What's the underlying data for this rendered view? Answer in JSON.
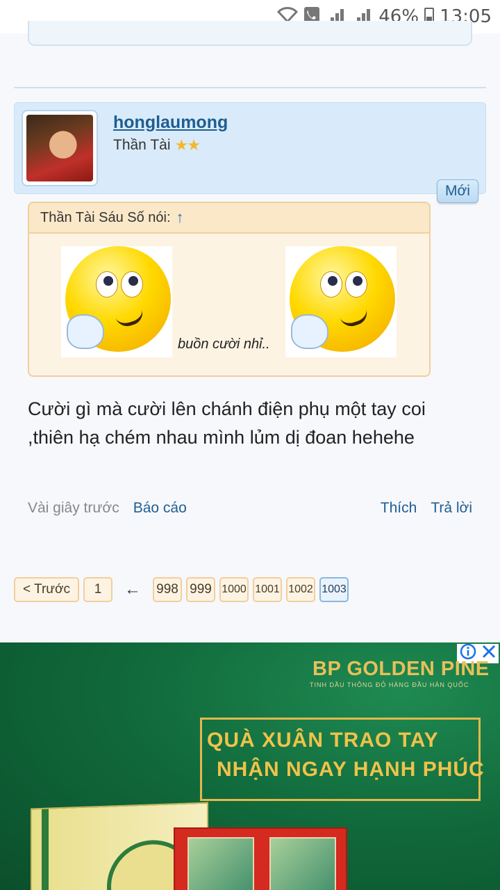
{
  "status_bar": {
    "battery": "46%",
    "time": "13:05"
  },
  "post": {
    "username": "honglaumong",
    "rank": "Thần Tài",
    "new_badge": "Mới",
    "quote": {
      "author_line": "Thần Tài Sáu Số nói:",
      "up_arrow": "↑",
      "text": "buồn cười nhỉ.."
    },
    "body": "Cười gì mà cười lên chánh điện phụ một tay coi ,thiên hạ chém nhau mình lủm dị đoan hehehe",
    "time": "Vài giây trước",
    "report": "Báo cáo",
    "like": "Thích",
    "reply": "Trả lời"
  },
  "pagination": {
    "prev": "< Trước",
    "first": "1",
    "gap_arrow": "←",
    "pages": [
      "998",
      "999",
      "1000",
      "1001",
      "1002",
      "1003"
    ],
    "current": "1003"
  },
  "ad": {
    "brand": "BP GOLDEN PINE",
    "tagline": "TINH DẦU THÔNG ĐỎ HÀNG ĐẦU HÀN QUỐC",
    "line1": "QUÀ XUÂN TRAO TAY",
    "line2": "NHẬN NGAY HẠNH PHÚC",
    "info_icon": "info-icon",
    "close_icon": "close-icon"
  }
}
